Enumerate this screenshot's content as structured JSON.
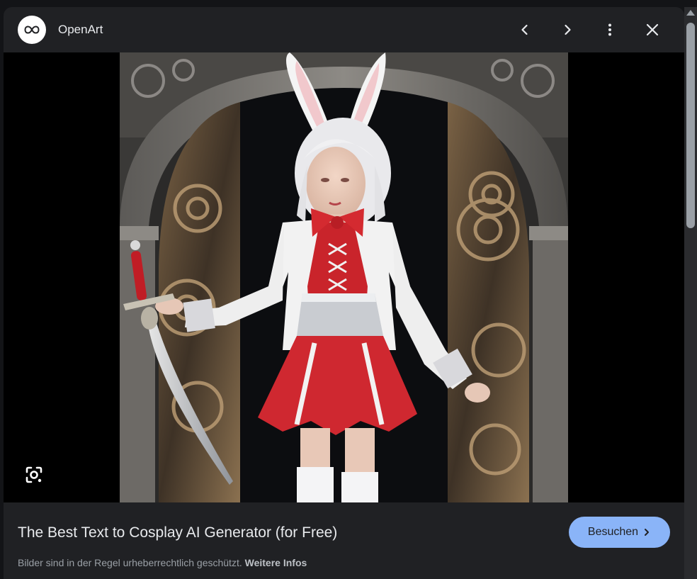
{
  "header": {
    "site_name": "OpenArt",
    "logo_icon": "infinity-icon",
    "buttons": [
      "chevron-left-icon",
      "chevron-right-icon",
      "more-vert-icon",
      "close-icon"
    ]
  },
  "image": {
    "lens_icon": "lens-search-icon"
  },
  "footer": {
    "title": "The Best Text to Cosplay AI Generator (for Free)",
    "visit_label": "Besuchen",
    "notice_text": "Bilder sind in der Regel urheberrechtlich geschützt.",
    "notice_link": "Weitere Infos"
  },
  "colors": {
    "background": "#202124",
    "accent": "#8ab4f8",
    "text": "#e8eaed",
    "muted": "#9aa0a6"
  }
}
